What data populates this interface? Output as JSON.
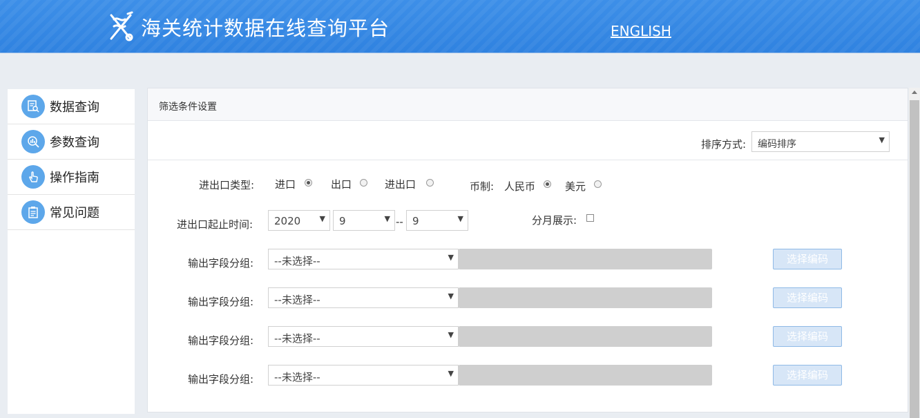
{
  "header": {
    "title": "海关统计数据在线查询平台",
    "english_link": "ENGLISH",
    "logo_icon": "caduceus-key-icon"
  },
  "sidebar": {
    "items": [
      {
        "label": "数据查询",
        "icon": "data-query-icon"
      },
      {
        "label": "参数查询",
        "icon": "param-chart-icon"
      },
      {
        "label": "操作指南",
        "icon": "hand-pointer-icon"
      },
      {
        "label": "常见问题",
        "icon": "clipboard-icon"
      }
    ]
  },
  "panel": {
    "title": "筛选条件设置",
    "sort": {
      "label": "排序方式:",
      "value": "编码排序"
    },
    "trade_type": {
      "label": "进出口类型:",
      "options": [
        {
          "label": "进口",
          "selected": true
        },
        {
          "label": "出口",
          "selected": false
        },
        {
          "label": "进出口",
          "selected": false
        }
      ]
    },
    "currency": {
      "label": "币制:",
      "options": [
        {
          "label": "人民币",
          "selected": true
        },
        {
          "label": "美元",
          "selected": false
        }
      ]
    },
    "time": {
      "label": "进出口起止时间:",
      "year": "2020",
      "start_month": "9",
      "separator": "--",
      "end_month": "9"
    },
    "monthly": {
      "label": "分月展示:",
      "checked": false
    },
    "field_groups": [
      {
        "label": "输出字段分组:",
        "value": "--未选择--",
        "button": "选择编码"
      },
      {
        "label": "输出字段分组:",
        "value": "--未选择--",
        "button": "选择编码"
      },
      {
        "label": "输出字段分组:",
        "value": "--未选择--",
        "button": "选择编码"
      },
      {
        "label": "输出字段分组:",
        "value": "--未选择--",
        "button": "选择编码"
      }
    ]
  }
}
